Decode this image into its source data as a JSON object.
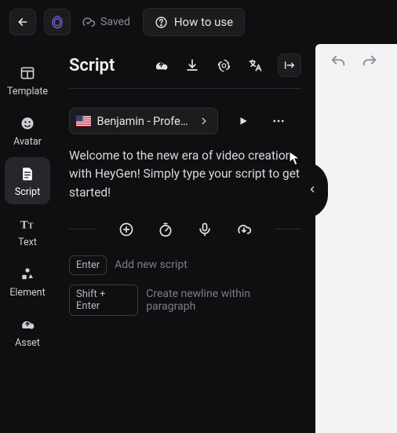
{
  "topbar": {
    "saved_label": "Saved",
    "howto_label": "How to use"
  },
  "rail": {
    "items": [
      {
        "label": "Template"
      },
      {
        "label": "Avatar"
      },
      {
        "label": "Script"
      },
      {
        "label": "Text"
      },
      {
        "label": "Element"
      },
      {
        "label": "Asset"
      }
    ]
  },
  "panel": {
    "title": "Script",
    "voice": {
      "name": "Benjamin - Profess…"
    },
    "script_text": "Welcome to the new era of video creation with HeyGen! Simply type your script to get started!",
    "hints": {
      "enter_key": "Enter",
      "enter_label": "Add new script",
      "shift_key": "Shift + Enter",
      "shift_label": "Create newline within paragraph"
    }
  }
}
